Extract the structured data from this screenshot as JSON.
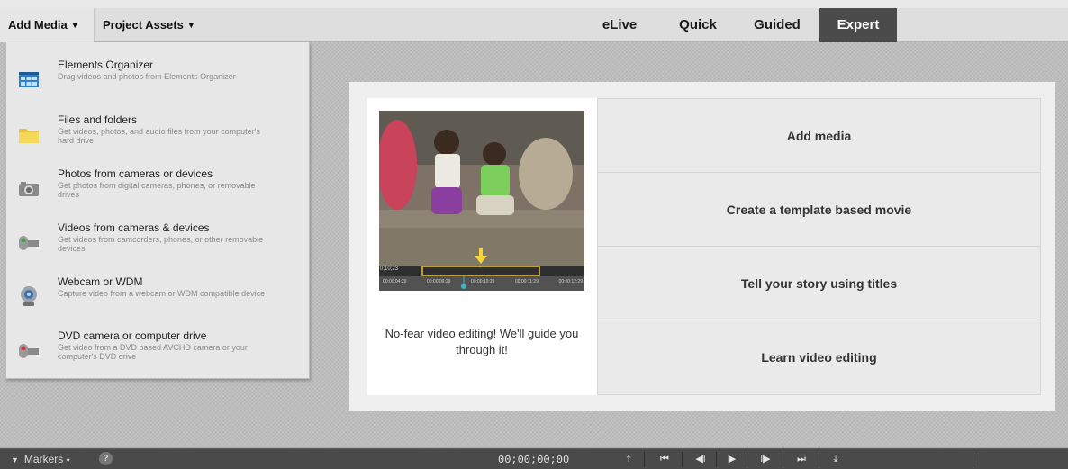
{
  "header": {
    "add_media": "Add Media",
    "project_assets": "Project Assets",
    "tabs": [
      {
        "label": "eLive"
      },
      {
        "label": "Quick"
      },
      {
        "label": "Guided"
      },
      {
        "label": "Expert"
      }
    ],
    "active_tab": "Expert"
  },
  "dropdown": {
    "items": [
      {
        "title": "Elements Organizer",
        "desc": "Drag videos and photos from Elements Organizer",
        "icon": "organizer-grid-icon"
      },
      {
        "title": "Files and folders",
        "desc": "Get videos, photos, and audio files from your computer's hard drive",
        "icon": "folder-icon"
      },
      {
        "title": "Photos from cameras or devices",
        "desc": "Get photos from digital cameras, phones, or removable drives",
        "icon": "camera-icon"
      },
      {
        "title": "Videos from cameras & devices",
        "desc": "Get videos from camcorders, phones, or other removable devices",
        "icon": "camcorder-icon"
      },
      {
        "title": "Webcam or WDM",
        "desc": "Capture video from a webcam or WDM compatible device",
        "icon": "webcam-icon"
      },
      {
        "title": "DVD camera or computer drive",
        "desc": "Get video from a DVD based AVCHD camera or your computer's DVD drive",
        "icon": "dvd-camcorder-icon"
      }
    ]
  },
  "welcome": {
    "tagline": "No-fear video editing! We'll guide you through it!",
    "timeline_codes": [
      "00:00:04:29",
      "00:00:09:29",
      "00:00:10:29",
      "00:00:11:29",
      "00:00:12:29"
    ],
    "timeline_start": "0;10;23",
    "options": [
      {
        "label": "Add media"
      },
      {
        "label": "Create a template based movie"
      },
      {
        "label": "Tell your story using titles"
      },
      {
        "label": "Learn video editing"
      }
    ]
  },
  "bottombar": {
    "markers_label": "Markers",
    "help": "?",
    "timecode": "00;00;00;00"
  },
  "colors": {
    "active_tab_bg": "#4b4b4b",
    "bottombar_bg": "#4a4a4a",
    "arrow_yellow": "#f5d33a"
  }
}
